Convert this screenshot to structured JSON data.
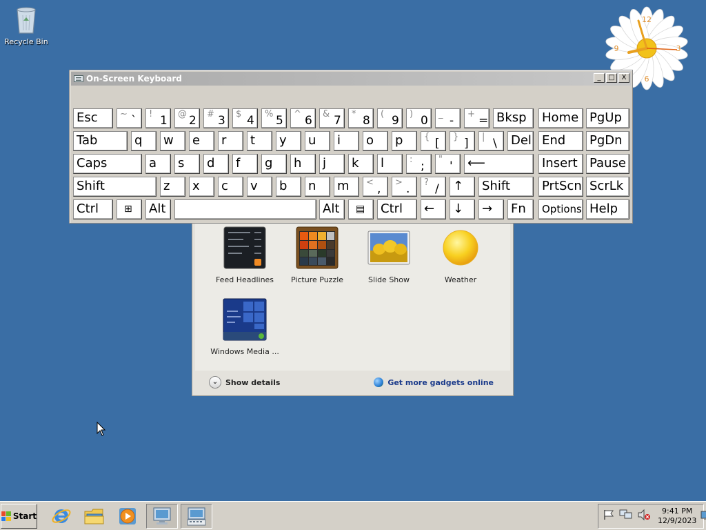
{
  "desktop": {
    "icons": [
      {
        "label": "Recycle Bin",
        "icon": "recycle-bin-icon"
      }
    ]
  },
  "clock_gadget": {
    "numerals": [
      "12",
      "3",
      "6",
      "9"
    ]
  },
  "gadget_gallery": {
    "gadgets": [
      {
        "label": "Feed Headlines",
        "icon": "feed-headlines-icon"
      },
      {
        "label": "Picture Puzzle",
        "icon": "picture-puzzle-icon"
      },
      {
        "label": "Slide Show",
        "icon": "slide-show-icon"
      },
      {
        "label": "Weather",
        "icon": "weather-sun-icon"
      },
      {
        "label": "Windows Media ...",
        "icon": "windows-media-center-icon"
      }
    ],
    "show_details": "Show details",
    "get_more": "Get more gadgets online"
  },
  "osk": {
    "title": "On-Screen Keyboard",
    "controls": {
      "minimize": "_",
      "maximize": "□",
      "close": "X"
    },
    "rows": [
      [
        {
          "label": "Esc"
        },
        {
          "up": "~",
          "down": "`"
        },
        {
          "up": "!",
          "down": "1"
        },
        {
          "up": "@",
          "down": "2"
        },
        {
          "up": "#",
          "down": "3"
        },
        {
          "up": "$",
          "down": "4"
        },
        {
          "up": "%",
          "down": "5"
        },
        {
          "up": "^",
          "down": "6"
        },
        {
          "up": "&",
          "down": "7"
        },
        {
          "up": "*",
          "down": "8"
        },
        {
          "up": "(",
          "down": "9"
        },
        {
          "up": ")",
          "down": "0"
        },
        {
          "up": "_",
          "down": "-"
        },
        {
          "up": "+",
          "down": "="
        },
        {
          "label": "Bksp"
        },
        {
          "label": "Home"
        },
        {
          "label": "PgUp"
        }
      ],
      [
        {
          "label": "Tab"
        },
        {
          "label": "q"
        },
        {
          "label": "w"
        },
        {
          "label": "e"
        },
        {
          "label": "r"
        },
        {
          "label": "t"
        },
        {
          "label": "y"
        },
        {
          "label": "u"
        },
        {
          "label": "i"
        },
        {
          "label": "o"
        },
        {
          "label": "p"
        },
        {
          "up": "{",
          "down": "["
        },
        {
          "up": "}",
          "down": "]"
        },
        {
          "up": "|",
          "down": "\\"
        },
        {
          "label": "Del"
        },
        {
          "label": "End"
        },
        {
          "label": "PgDn"
        }
      ],
      [
        {
          "label": "Caps"
        },
        {
          "label": "a"
        },
        {
          "label": "s"
        },
        {
          "label": "d"
        },
        {
          "label": "f"
        },
        {
          "label": "g"
        },
        {
          "label": "h"
        },
        {
          "label": "j"
        },
        {
          "label": "k"
        },
        {
          "label": "l"
        },
        {
          "up": ":",
          "down": ";"
        },
        {
          "up": "\"",
          "down": "'"
        },
        {
          "label": "⟵"
        },
        {
          "label": "Insert"
        },
        {
          "label": "Pause"
        }
      ],
      [
        {
          "label": "Shift"
        },
        {
          "label": "z"
        },
        {
          "label": "x"
        },
        {
          "label": "c"
        },
        {
          "label": "v"
        },
        {
          "label": "b"
        },
        {
          "label": "n"
        },
        {
          "label": "m"
        },
        {
          "up": "<",
          "down": ","
        },
        {
          "up": ">",
          "down": "."
        },
        {
          "up": "?",
          "down": "/"
        },
        {
          "label": "↑"
        },
        {
          "label": "Shift"
        },
        {
          "label": "PrtScn"
        },
        {
          "label": "ScrLk"
        }
      ],
      [
        {
          "label": "Ctrl"
        },
        {
          "label": "",
          "icon": "windows-logo-icon"
        },
        {
          "label": "Alt"
        },
        {
          "label": ""
        },
        {
          "label": "Alt"
        },
        {
          "label": "",
          "icon": "menu-key-icon"
        },
        {
          "label": "Ctrl"
        },
        {
          "label": "←"
        },
        {
          "label": "↓"
        },
        {
          "label": "→"
        },
        {
          "label": "Fn"
        },
        {
          "label": "Options",
          "small": true
        },
        {
          "label": "Help"
        }
      ]
    ]
  },
  "taskbar": {
    "start_label": "Start",
    "quick_launch": [
      "internet-explorer-icon",
      "file-explorer-icon",
      "media-player-icon",
      "computer-icon",
      "on-screen-keyboard-icon"
    ],
    "tray_icons": [
      "action-center-flag-icon",
      "network-icon",
      "volume-muted-icon"
    ],
    "time": "9:41 PM",
    "date": "12/9/2023"
  }
}
